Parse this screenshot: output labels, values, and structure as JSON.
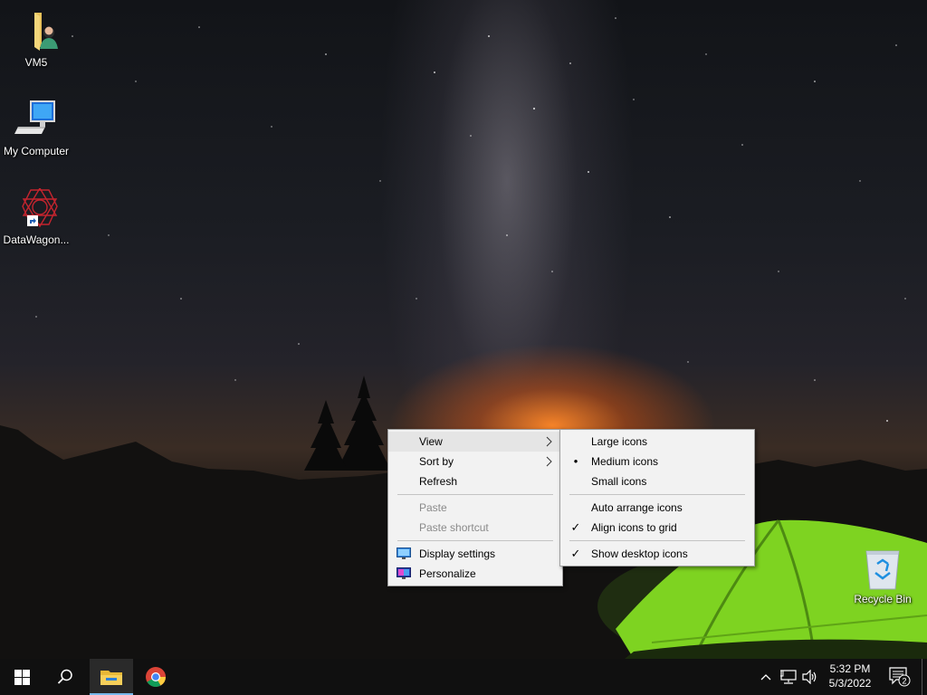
{
  "desktop": {
    "icons": [
      {
        "label": "VM5",
        "icon": "folder-user-icon"
      },
      {
        "label": "My Computer",
        "icon": "computer-icon"
      },
      {
        "label": "DataWagon...",
        "icon": "datawagon-shortcut-icon"
      },
      {
        "label": "Recycle Bin",
        "icon": "recycle-bin-icon"
      }
    ]
  },
  "context_menu": {
    "items": [
      {
        "label": "View",
        "submenu": true,
        "highlighted": true
      },
      {
        "label": "Sort by",
        "submenu": true
      },
      {
        "label": "Refresh"
      },
      {
        "label": "Paste",
        "disabled": true
      },
      {
        "label": "Paste shortcut",
        "disabled": true
      },
      {
        "label": "Display settings",
        "icon": "display-settings-icon"
      },
      {
        "label": "Personalize",
        "icon": "personalize-icon"
      }
    ]
  },
  "view_submenu": {
    "items": [
      {
        "label": "Large icons",
        "checked": false
      },
      {
        "label": "Medium icons",
        "checked": true,
        "mark": "•"
      },
      {
        "label": "Small icons",
        "checked": false
      },
      {
        "label": "Auto arrange icons",
        "checked": false
      },
      {
        "label": "Align icons to grid",
        "checked": true,
        "mark": "✓"
      },
      {
        "label": "Show desktop icons",
        "checked": true,
        "mark": "✓"
      }
    ]
  },
  "taskbar": {
    "start_icon": "windows-logo-icon",
    "search_icon": "search-icon",
    "pinned": [
      {
        "name": "file-explorer-icon",
        "active": true
      },
      {
        "name": "chrome-icon",
        "active": false
      }
    ],
    "tray": {
      "icons": [
        "chevron-up-icon",
        "network-icon",
        "volume-icon"
      ],
      "time": "5:32 PM",
      "date": "5/3/2022",
      "notification_count": "2"
    }
  },
  "colors": {
    "menu_bg": "#f2f2f2",
    "menu_hover": "#ffffff",
    "taskbar_bg": "#101010",
    "tent_green": "#7ed321"
  }
}
